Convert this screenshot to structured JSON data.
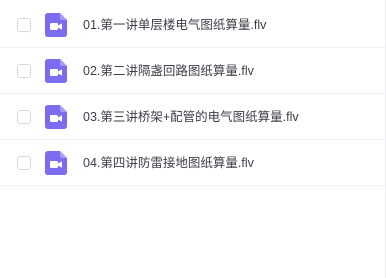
{
  "files": [
    {
      "name": "01.第一讲单层楼电气图纸算量.flv",
      "icon": "video-file-icon"
    },
    {
      "name": "02.第二讲隔盏回路图纸算量.flv",
      "icon": "video-file-icon"
    },
    {
      "name": "03.第三讲桥架+配管的电气图纸算量.flv",
      "icon": "video-file-icon"
    },
    {
      "name": "04.第四讲防雷接地图纸算量.flv",
      "icon": "video-file-icon"
    }
  ],
  "colors": {
    "icon_bg": "#7B6CF0",
    "icon_fold": "#A79BF7",
    "text": "#3B3F47",
    "checkbox_border": "#D5D8DE"
  }
}
